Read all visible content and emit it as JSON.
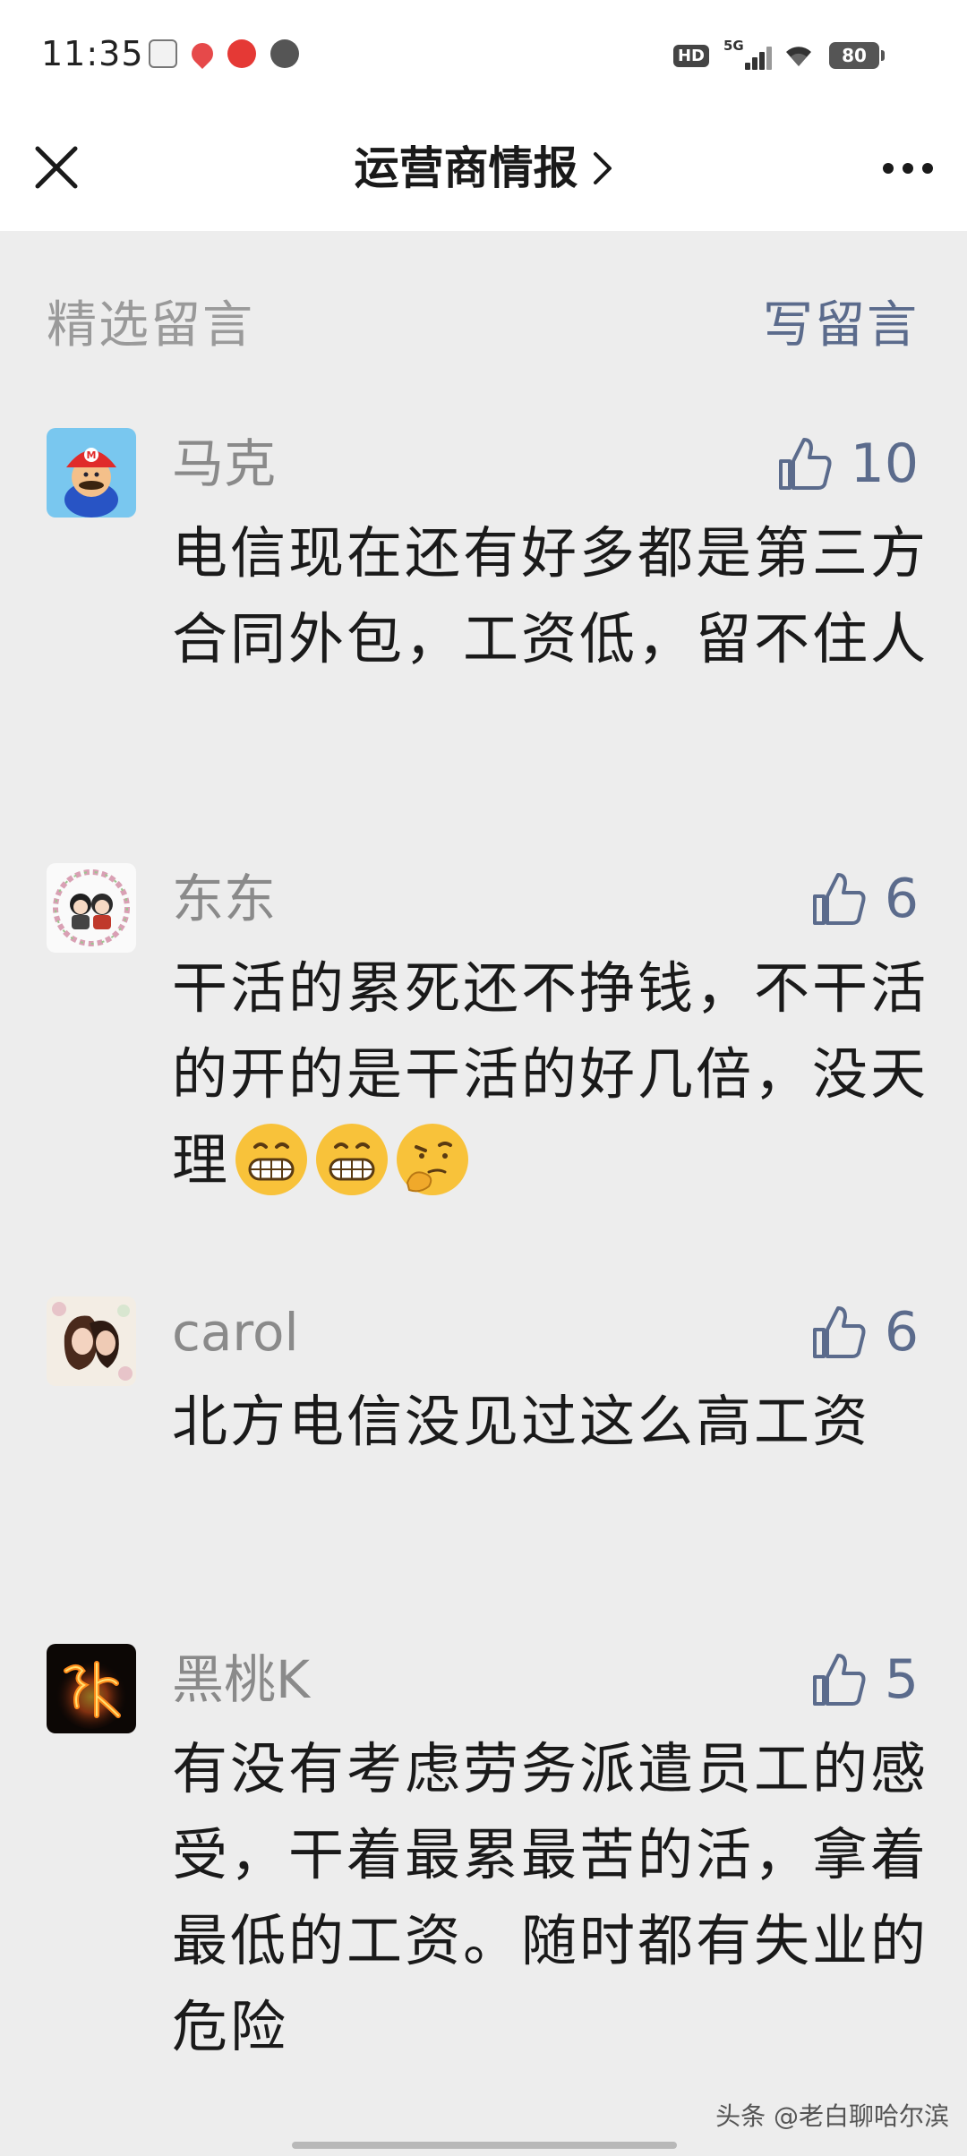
{
  "status_bar": {
    "time": "11:35",
    "network": "5G",
    "hd": "HD",
    "battery": "80",
    "icons": [
      "toutiao-icon",
      "map-pin-icon",
      "video-icon",
      "chat-bubble-icon",
      "signal-icon",
      "wifi-icon",
      "battery-icon"
    ]
  },
  "nav": {
    "title": "运营商情报",
    "icons": [
      "close-icon",
      "chevron-right-icon",
      "more-icon"
    ]
  },
  "section": {
    "title": "精选留言",
    "write_label": "写留言"
  },
  "comments": [
    {
      "name": "马克",
      "likes": "10",
      "text": "电信现在还有好多都是第三方合同外包，工资低，留不住人",
      "avatar": "mario-avatar"
    },
    {
      "name": "东东",
      "likes": "6",
      "text": "干活的累死还不挣钱，不干活的开的是干活的好几倍，没天理",
      "emojis": [
        "grin-emoji",
        "grin-emoji",
        "thinking-emoji"
      ],
      "avatar": "cartoon-couple-avatar"
    },
    {
      "name": "carol",
      "likes": "6",
      "text": "北方电信没见过这么高工资",
      "avatar": "couple-photo-avatar"
    },
    {
      "name": "黑桃K",
      "likes": "5",
      "text": "有没有考虑劳务派遣员工的感受，干着最累最苦的活，拿着最低的工资。随时都有失业的危险",
      "avatar": "fire-zhang-avatar"
    }
  ],
  "footer": {
    "watermark": "头条 @老白聊哈尔滨"
  },
  "colors": {
    "background": "#ededed",
    "link": "#5b6b8c",
    "muted": "#9a9a9a"
  }
}
